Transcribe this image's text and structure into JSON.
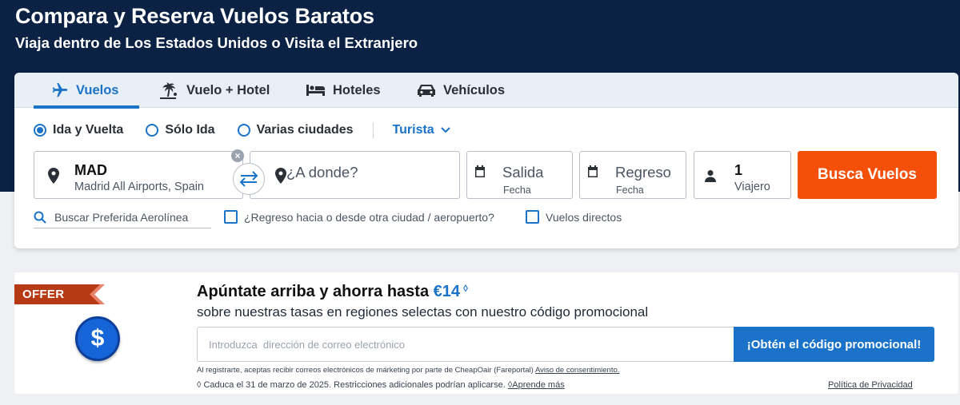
{
  "hero": {
    "title": "Compara y Reserva Vuelos Baratos",
    "subtitle": "Viaja dentro de Los Estados Unidos o Visita el Extranjero"
  },
  "tabs": [
    {
      "label": "Vuelos",
      "icon": "airplane-icon",
      "active": true
    },
    {
      "label": "Vuelo + Hotel",
      "icon": "beach-icon",
      "active": false
    },
    {
      "label": "Hoteles",
      "icon": "bed-icon",
      "active": false
    },
    {
      "label": "Vehículos",
      "icon": "car-icon",
      "active": false
    }
  ],
  "trip_types": [
    {
      "label": "Ida y Vuelta",
      "selected": true
    },
    {
      "label": "Sólo Ida",
      "selected": false
    },
    {
      "label": "Varias ciudades",
      "selected": false
    }
  ],
  "cabin": {
    "value": "Turista"
  },
  "origin": {
    "code": "MAD",
    "name": "Madrid All Airports, Spain"
  },
  "destination": {
    "placeholder": "¿A donde?"
  },
  "departure": {
    "label": "Salida",
    "sub": "Fecha"
  },
  "return": {
    "label": "Regreso",
    "sub": "Fecha"
  },
  "travelers": {
    "count": "1",
    "label": "Viajero"
  },
  "search_button": "Busca Vuelos",
  "airline_search": {
    "placeholder": "Buscar Preferida Aerolínea"
  },
  "options": {
    "different_return": "¿Regreso hacia o desde otra ciudad / aeropuerto?",
    "direct_flights": "Vuelos directos"
  },
  "promo": {
    "ribbon": "OFFER",
    "title_prefix": "Apúntate arriba y ahorra hasta",
    "amount": "€14",
    "amount_mark": "◊",
    "subtitle": "sobre nuestras tasas en regiones selectas con nuestro código promocional",
    "email_placeholder": "Introduzca  dirección de correo electrónico",
    "button": "¡Obtén el código promocional!",
    "legal_text": "Al registrarte, aceptas recibir correos electrónicos de márketing por parte de CheapOair (Fareportal)",
    "legal_link": "Aviso de consentimiento.",
    "expiry_text": "◊ Caduca el 31 de marzo de 2025. Restricciones adicionales podrían aplicarse.",
    "learn_more": "◊Aprende más",
    "privacy": "Política de Privacidad",
    "coin_symbol": "$"
  },
  "colors": {
    "hero_bg": "#0b2245",
    "accent": "#1a73c8",
    "search_button": "#f5500a"
  }
}
